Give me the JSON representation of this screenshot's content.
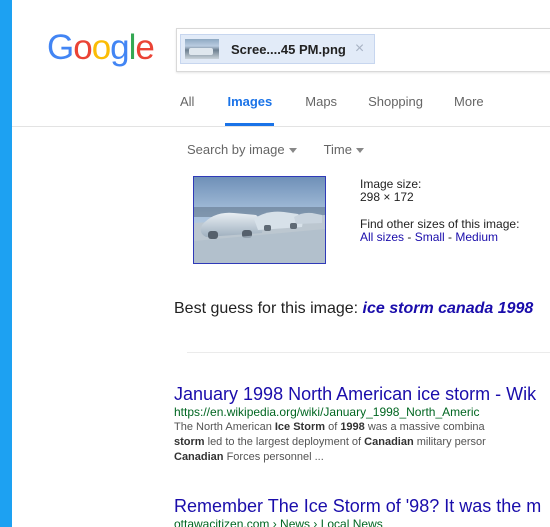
{
  "logo": {
    "letters": [
      "G",
      "o",
      "o",
      "g",
      "l",
      "e"
    ],
    "colors": [
      "#4285F4",
      "#EA4335",
      "#FBBC05",
      "#4285F4",
      "#34A853",
      "#EA4335"
    ]
  },
  "search": {
    "chip_label": "Scree....45 PM.png",
    "chip_close": "×"
  },
  "tabs": [
    {
      "label": "All"
    },
    {
      "label": "Images"
    },
    {
      "label": "Maps"
    },
    {
      "label": "Shopping"
    },
    {
      "label": "More"
    }
  ],
  "active_tab": "Images",
  "tools": {
    "search_by_image": "Search by image",
    "time": "Time"
  },
  "image_info": {
    "size_label": "Image size:",
    "size_value": "298 × 172",
    "find_other": "Find other sizes of this image:",
    "all_sizes": "All sizes",
    "small": "Small",
    "medium": "Medium",
    "sep": " - "
  },
  "best_guess": {
    "prefix": "Best guess for this image: ",
    "query": "ice storm canada 1998"
  },
  "results": [
    {
      "title": "January 1998 North American ice storm - Wik",
      "url": "https://en.wikipedia.org/wiki/January_1998_North_Americ",
      "snippet_lines": [
        [
          {
            "t": "The North American ",
            "b": false
          },
          {
            "t": "Ice Storm",
            "b": true
          },
          {
            "t": " of ",
            "b": false
          },
          {
            "t": "1998",
            "b": true
          },
          {
            "t": " was a massive combina",
            "b": false
          }
        ],
        [
          {
            "t": "storm",
            "b": true
          },
          {
            "t": " led to the largest deployment of ",
            "b": false
          },
          {
            "t": "Canadian",
            "b": true
          },
          {
            "t": " military persor",
            "b": false
          }
        ],
        [
          {
            "t": "Canadian",
            "b": true
          },
          {
            "t": " Forces personnel ...",
            "b": false
          }
        ]
      ]
    },
    {
      "title": "Remember The Ice Storm of '98? It was the m",
      "url": "ottawacitizen.com › News › Local News",
      "snippet_lines": []
    }
  ],
  "colors": {
    "left_bar": "#1DA1F2",
    "link": "#1A0DAB",
    "active_tab": "#1A73E8",
    "url_green": "#006621"
  }
}
